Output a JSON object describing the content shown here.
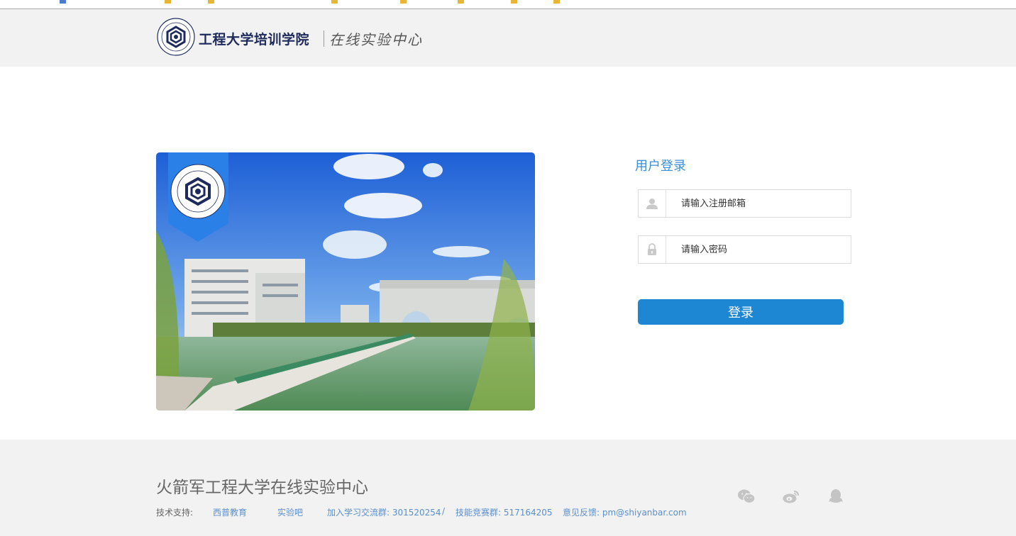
{
  "header": {
    "brand_name": "工程大学培训学院",
    "brand_subtitle": "在线实验中心"
  },
  "login": {
    "title": "用户登录",
    "email_placeholder": "请输入注册邮箱",
    "password_placeholder": "请输入密码",
    "submit_label": "登录"
  },
  "footer": {
    "title": "火箭军工程大学在线实验中心",
    "support_label": "技术支持:",
    "support_link_1": "西普教育",
    "support_link_2": "实验吧",
    "study_group": "加入学习交流群: 301520254",
    "separator": "/",
    "contest_group": "技能竞赛群: 517164205",
    "feedback": "意见反馈: pm@shiyanbar.com"
  },
  "social_icons": [
    "wechat-icon",
    "weibo-icon",
    "qq-icon"
  ],
  "colors": {
    "accent": "#1e87d3",
    "title_blue": "#3b8fd6",
    "footer_bg": "#f2f2f2",
    "brand_navy": "#1f2a5c"
  }
}
